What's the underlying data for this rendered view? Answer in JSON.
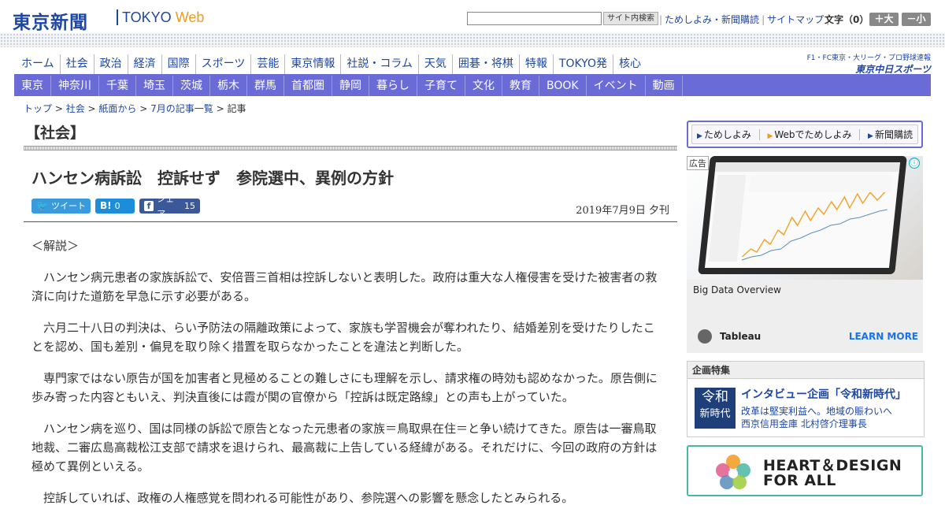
{
  "header": {
    "logo_jp": "東京新聞",
    "logo_en_tokyo": "TOKYO",
    "logo_en_web": "Web",
    "search_button": "サイト内検索",
    "links": [
      "ためしよみ・新聞購読",
      "サイトマップ"
    ],
    "font_label": "文字（0）",
    "font_larger": "＋大",
    "font_smaller": "－小"
  },
  "nav_primary": [
    "ホーム",
    "社会",
    "政治",
    "経済",
    "国際",
    "スポーツ",
    "芸能",
    "東京情報",
    "社説・コラム",
    "天気",
    "囲碁・将棋",
    "特報",
    "TOKYO発",
    "核心"
  ],
  "nav_secondary": [
    "東京",
    "神奈川",
    "千葉",
    "埼玉",
    "茨城",
    "栃木",
    "群馬",
    "首都圏",
    "静岡",
    "暮らし",
    "子育て",
    "文化",
    "教育",
    "BOOK",
    "イベント",
    "動画"
  ],
  "chunichi": {
    "line1": "F1・FC東京・大リーグ・プロ野球速報",
    "line2": "東京中日スポーツ"
  },
  "breadcrumb": [
    "トップ",
    "社会",
    "紙面から",
    "7月の記事一覧",
    "記事"
  ],
  "category": "【社会】",
  "headline": "ハンセン病訴訟　控訴せず　参院選中、異例の方針",
  "share": {
    "tweet": "ツイート",
    "hatena_icon": "B!",
    "hatena_count": "0",
    "facebook_label": "シェア",
    "facebook_count": "15"
  },
  "date": "2019年7月9日 夕刊",
  "article": [
    "＜解説＞",
    "　ハンセン病元患者の家族訴訟で、安倍晋三首相は控訴しないと表明した。政府は重大な人権侵害を受けた被害者の救済に向けた道筋を早急に示す必要がある。",
    "　六月二十八日の判決は、らい予防法の隔離政策によって、家族も学習機会が奪われたり、結婚差別を受けたりしたことを認め、国も差別・偏見を取り除く措置を取らなかったことを違法と判断した。",
    "　専門家ではない原告が国を加害者と見極めることの難しさにも理解を示し、請求権の時効も認めなかった。原告側に歩み寄った内容ともいえ、判決直後には霞が関の官僚から「控訴は既定路線」との声も上がっていた。",
    "　ハンセン病を巡り、国は同様の訴訟で原告となった元患者の家族＝鳥取県在住＝と争い続けてきた。原告は一審鳥取地裁、二審広島高裁松江支部で請求を退けられ、最高裁に上告している経緯がある。それだけに、今回の政府の方針は極めて異例といえる。",
    "　控訴していれば、政権の人権感覚を問われる可能性があり、参院選への影響を懸念したとみられる。"
  ],
  "subnav": [
    "ためしよみ",
    "Webでためしよみ",
    "新聞購読"
  ],
  "ad": {
    "tag": "広告",
    "title": "Big Data Overview",
    "brand": "Tableau",
    "cta": "LEARN MORE"
  },
  "feature": {
    "heading": "企画特集",
    "img_line1": "令和",
    "img_line2": "新時代",
    "title": "インタビュー企画「令和新時代」",
    "desc1": "改革は堅実利益へ。地域の賑わいへ",
    "desc2": "西京信用金庫 北村啓介理事長"
  },
  "banner": {
    "line1": "HEART＆DESIGN",
    "line2": "FOR ALL"
  },
  "colors": {
    "brand_blue": "#1e46a3",
    "nav_purple": "#6b6bd8",
    "accent_orange": "#f29a1f",
    "banner_teal": "#4ab7a5"
  }
}
